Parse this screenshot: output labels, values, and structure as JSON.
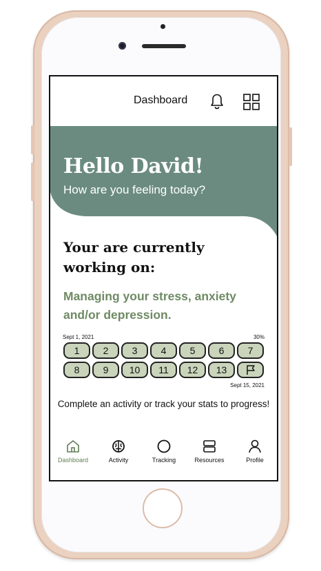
{
  "header": {
    "title": "Dashboard"
  },
  "hero": {
    "greeting": "Hello David!",
    "subtitle": "How are you feeling today?"
  },
  "program": {
    "heading": "Your are currently working on:",
    "focus": "Managing your stress, anxiety and/or depression.",
    "start_date": "Sept 1, 2021",
    "end_date": "Sept 15, 2021",
    "progress_label": "30%",
    "progress": 0.3,
    "days": [
      "1",
      "2",
      "3",
      "4",
      "5",
      "6",
      "7",
      "8",
      "9",
      "10",
      "11",
      "12",
      "13"
    ],
    "final_day_icon": "flag-icon"
  },
  "instruction": "Complete an activity or track your stats to progress!",
  "nav": [
    {
      "label": "Dashboard",
      "icon": "home-icon",
      "active": true
    },
    {
      "label": "Activity",
      "icon": "brain-icon",
      "active": false
    },
    {
      "label": "Tracking",
      "icon": "circle-icon",
      "active": false
    },
    {
      "label": "Resources",
      "icon": "stack-icon",
      "active": false
    },
    {
      "label": "Profile",
      "icon": "person-icon",
      "active": false
    }
  ],
  "colors": {
    "accent": "#6b8b80",
    "focus_text": "#6f8a64",
    "chip_fill": "#c9d4bb",
    "nav_active": "#5f7f55"
  }
}
